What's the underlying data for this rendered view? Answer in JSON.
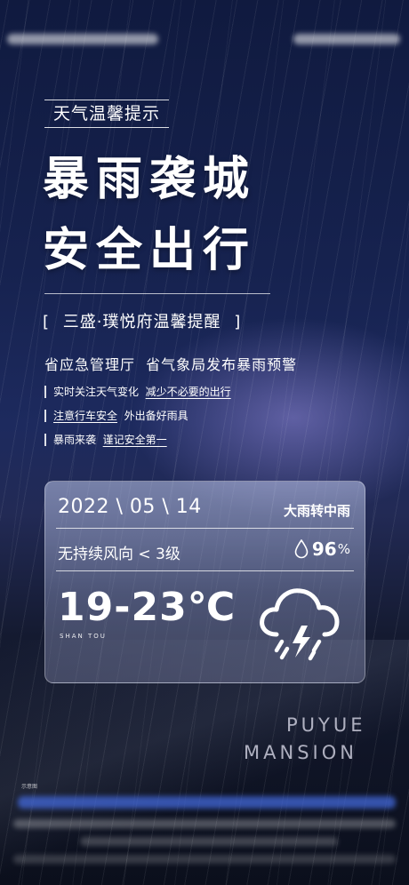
{
  "tag": "天气温馨提示",
  "headline": {
    "line1": "暴雨袭城",
    "line2": "安全出行"
  },
  "sponsor": {
    "open": "[",
    "name": "三盛·璞悦府温馨提醒",
    "close": "]"
  },
  "notice": "省应急管理厅  省气象局发布暴雨预警",
  "tips": [
    {
      "a": "实时关注天气变化",
      "b": "减少不必要的出行"
    },
    {
      "a": "注意行车安全",
      "b": "外出备好雨具"
    },
    {
      "a": "暴雨来袭",
      "b": "谨记安全第一"
    }
  ],
  "weather": {
    "date": "2022 \\ 05 \\ 14",
    "condition": "大雨转中雨",
    "wind": "无持续风向 < 3级",
    "humidity": "96",
    "humidity_unit": "%",
    "temperature": "19-23℃",
    "city": "SHAN TOU",
    "icon": "rain-cloud-lightning-icon",
    "drop_icon": "water-drop-icon"
  },
  "brand": {
    "line1": "PUYUE",
    "line2": "MANSION"
  },
  "footnote": "示意图",
  "colors": {
    "background": "#16224f",
    "card": "#b4bce0",
    "text": "#ffffff"
  }
}
